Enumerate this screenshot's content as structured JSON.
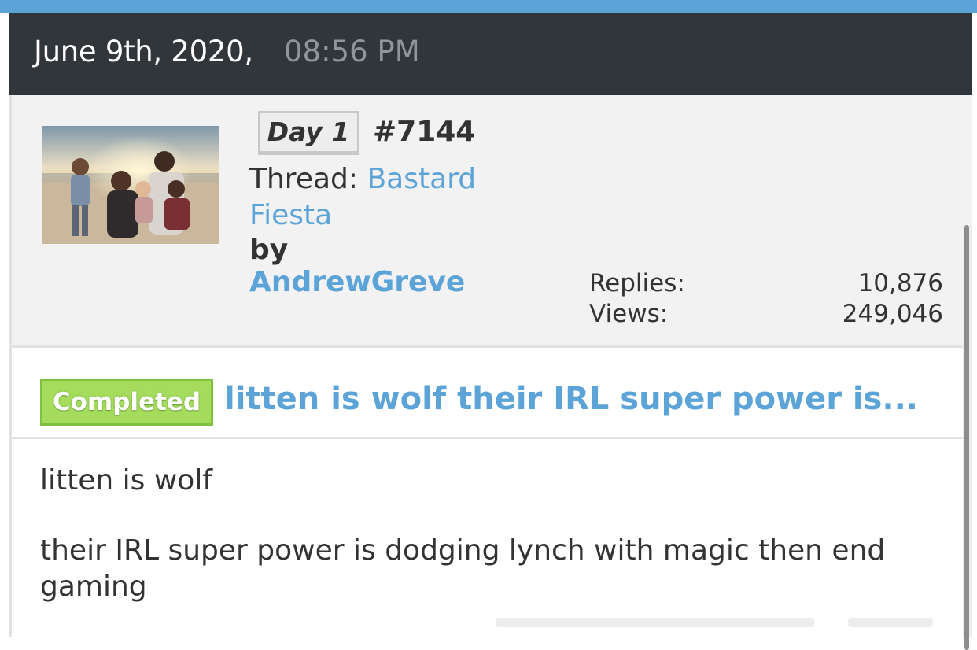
{
  "post_header": {
    "date": "June 9th, 2020,",
    "time": "08:56 PM"
  },
  "thread_info": {
    "avatar_alt": "family-photo",
    "day_badge": "Day 1",
    "post_number": "#7144",
    "thread_label": "Thread: ",
    "thread_name": "Bastard Fiesta",
    "by_label": "by ",
    "author": "AndrewGreve",
    "stats": {
      "replies_label": "Replies:",
      "replies_value": "10,876",
      "views_label": "Views:",
      "views_value": "249,046"
    }
  },
  "post_title": {
    "status_badge": "Completed",
    "title": "litten is wolf their IRL super power is..."
  },
  "post_body": {
    "line1": "litten is wolf",
    "line2": "their IRL super power is dodging lynch with magic then end gaming"
  },
  "colors": {
    "accent": "#5ca4d8",
    "header_bg": "#31363b",
    "completed_green": "#a5dc5c"
  }
}
